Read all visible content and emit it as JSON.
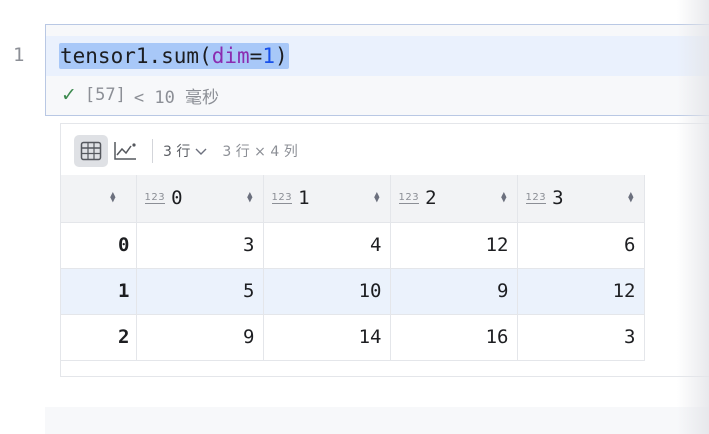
{
  "editor": {
    "line_number": "1",
    "code": {
      "prefix": "tensor1.sum(",
      "param": "dim",
      "equals": "=",
      "value": "1",
      "suffix": ")"
    },
    "status": {
      "exec_count": "[57]",
      "duration": "< 10 毫秒"
    }
  },
  "output": {
    "toolbar": {
      "table_view_icon": "table-icon",
      "chart_view_icon": "chart-icon",
      "rows_select": "3 行",
      "dims": "3 行 × 4 列"
    },
    "table": {
      "type_badge": "123",
      "columns": [
        "0",
        "1",
        "2",
        "3"
      ],
      "rows": [
        {
          "index": "0",
          "values": [
            "3",
            "4",
            "12",
            "6"
          ]
        },
        {
          "index": "1",
          "values": [
            "5",
            "10",
            "9",
            "12"
          ]
        },
        {
          "index": "2",
          "values": [
            "9",
            "14",
            "16",
            "3"
          ]
        }
      ]
    }
  },
  "colors": {
    "selection": "#a8c8f8",
    "keyword": "#8b2cb0",
    "number": "#1750eb",
    "success": "#3d8a4f",
    "striped_row": "#ebf2fc"
  }
}
